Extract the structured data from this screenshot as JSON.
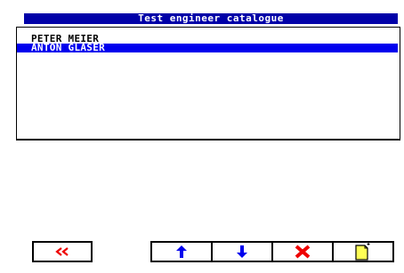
{
  "window": {
    "title": "Test engineer catalogue"
  },
  "list": {
    "items": [
      {
        "label": "PETER MEIER",
        "selected": false
      },
      {
        "label": "ANTON GLASER",
        "selected": true
      }
    ]
  },
  "toolbar": {
    "buttons": [
      {
        "name": "back-button",
        "icon": "double-chevron-left-icon"
      },
      {
        "name": "move-up-button",
        "icon": "arrow-up-icon"
      },
      {
        "name": "move-down-button",
        "icon": "arrow-down-icon"
      },
      {
        "name": "delete-button",
        "icon": "red-x-icon"
      },
      {
        "name": "new-entry-button",
        "icon": "new-document-icon"
      }
    ]
  },
  "colors": {
    "title_background": "#0000a8",
    "selection_background": "#0000ee",
    "arrow_blue": "#0000ee",
    "delete_red": "#ee0000",
    "document_yellow": "#ffff55"
  }
}
